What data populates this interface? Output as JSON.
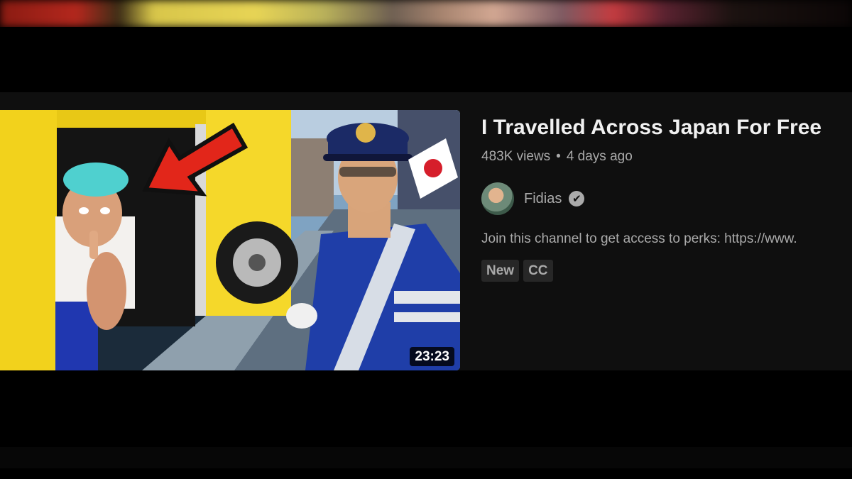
{
  "video": {
    "title": "I Travelled Across Japan For Free",
    "views": "483K views",
    "separator": "•",
    "age": "4 days ago",
    "duration": "23:23",
    "channel": "Fidias",
    "verified_glyph": "✔",
    "description": "Join this channel to get access to perks: https://www.",
    "badges": [
      "New",
      "CC"
    ]
  },
  "icons": {
    "verified": "verified-check-icon",
    "arrow": "red-arrow-graphic"
  },
  "colors": {
    "background": "#0f0f0f",
    "title": "#f1f1f1",
    "secondary_text": "#aaaaaa",
    "badge_bg": "#272727",
    "arrow_red": "#e2261a",
    "bus_yellow": "#f2d21c"
  }
}
